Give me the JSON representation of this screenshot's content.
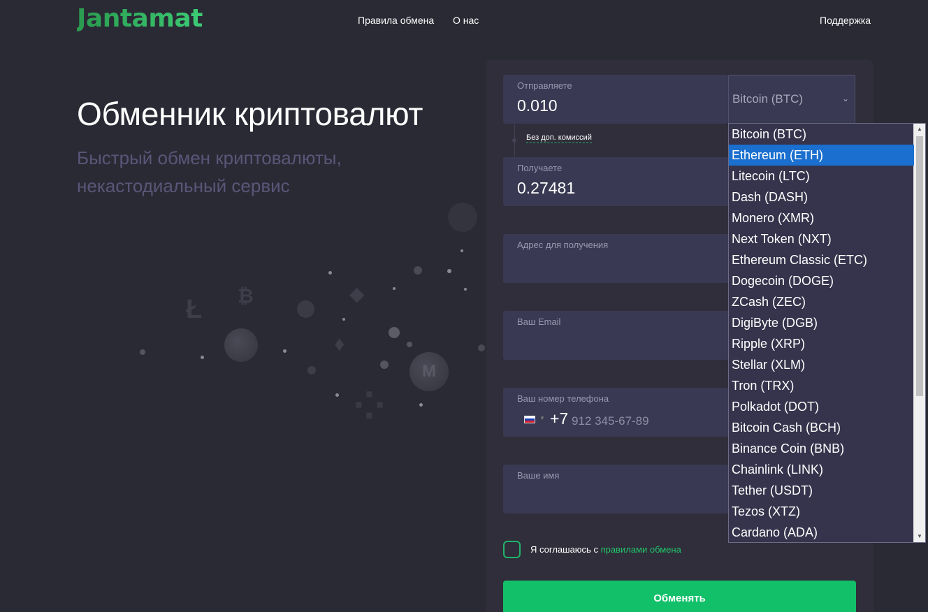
{
  "header": {
    "logo": "Jantamat",
    "nav": [
      "Правила обмена",
      "О нас"
    ],
    "support": "Поддержка"
  },
  "hero": {
    "title": "Обменник криптовалют",
    "subtitle": "Быстрый обмен криптовалюты, некастодиальный сервис"
  },
  "form": {
    "send": {
      "label": "Отправляете",
      "value": "0.010"
    },
    "send_currency": "Bitcoin (BTC)",
    "no_fee": "Без доп. комиссий",
    "receive": {
      "label": "Получаете",
      "value": "0.27481"
    },
    "address": {
      "label": "Адрес для получения"
    },
    "email": {
      "label": "Ваш Email"
    },
    "phone": {
      "label": "Ваш номер телефона",
      "prefix": "+7",
      "placeholder": "912 345-67-89"
    },
    "name": {
      "label": "Ваше имя"
    },
    "agree_text": "Я соглашаюсь с ",
    "agree_link": "правилами обмена",
    "submit": "Обменять"
  },
  "dropdown": {
    "highlighted_index": 1,
    "options": [
      "Bitcoin (BTC)",
      "Ethereum (ETH)",
      "Litecoin (LTC)",
      "Dash (DASH)",
      "Monero (XMR)",
      "Next Token (NXT)",
      "Ethereum Classic (ETC)",
      "Dogecoin (DOGE)",
      "ZCash (ZEC)",
      "DigiByte (DGB)",
      "Ripple (XRP)",
      "Stellar (XLM)",
      "Tron (TRX)",
      "Polkadot (DOT)",
      "Bitcoin Cash (BCH)",
      "Binance Coin (BNB)",
      "Chainlink (LINK)",
      "Tether (USDT)",
      "Tezos (XTZ)",
      "Cardano (ADA)"
    ]
  },
  "colors": {
    "brand": "#22a45a",
    "accent": "#13c06a",
    "highlight": "#1a6fcf"
  }
}
